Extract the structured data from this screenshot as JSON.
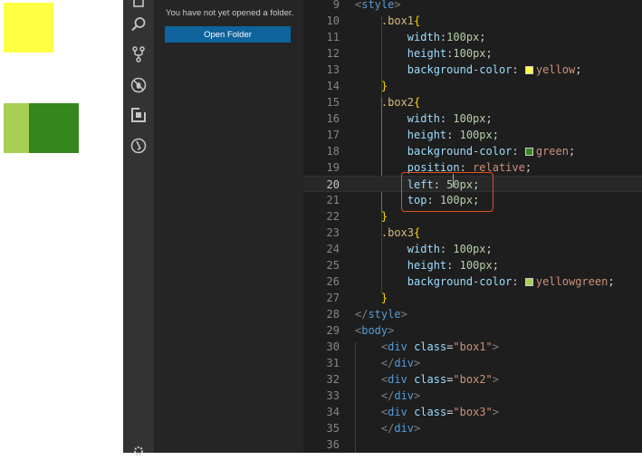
{
  "preview": {
    "box1_color": "#ffff44",
    "box2_color": "#35861d",
    "box3_color": "#a7cf53"
  },
  "sidebar": {
    "message": "You have not yet opened a folder.",
    "open_folder_label": "Open Folder"
  },
  "activity_icons": [
    "files-icon",
    "search-icon",
    "source-control-icon",
    "debug-icon",
    "extensions-icon",
    "remote-icon"
  ],
  "editor": {
    "current_line": 20,
    "lines": [
      {
        "n": "9",
        "indent": "",
        "tokens": [
          {
            "t": "<",
            "c": "c-angle"
          },
          {
            "t": "style",
            "c": "c-tag"
          },
          {
            "t": ">",
            "c": "c-angle"
          }
        ]
      },
      {
        "n": "10",
        "indent": "    ",
        "tokens": [
          {
            "t": ".box1",
            "c": "c-sel"
          },
          {
            "t": "{",
            "c": "c-brace"
          }
        ]
      },
      {
        "n": "11",
        "indent": "        ",
        "tokens": [
          {
            "t": "width",
            "c": "c-prop"
          },
          {
            "t": ":",
            "c": "c-punct"
          },
          {
            "t": "100px",
            "c": "c-num"
          },
          {
            "t": ";",
            "c": "c-punct"
          }
        ]
      },
      {
        "n": "12",
        "indent": "        ",
        "tokens": [
          {
            "t": "height",
            "c": "c-prop"
          },
          {
            "t": ":",
            "c": "c-punct"
          },
          {
            "t": "100px",
            "c": "c-num"
          },
          {
            "t": ";",
            "c": "c-punct"
          }
        ]
      },
      {
        "n": "13",
        "indent": "        ",
        "tokens": [
          {
            "t": "background-color",
            "c": "c-prop"
          },
          {
            "t": ": ",
            "c": "c-punct"
          },
          {
            "swatch": "#ffff44"
          },
          {
            "t": "yellow",
            "c": "c-val"
          },
          {
            "t": ";",
            "c": "c-punct"
          }
        ]
      },
      {
        "n": "14",
        "indent": "    ",
        "tokens": [
          {
            "t": "}",
            "c": "c-brace"
          }
        ]
      },
      {
        "n": "15",
        "indent": "    ",
        "tokens": [
          {
            "t": ".box2",
            "c": "c-sel"
          },
          {
            "t": "{",
            "c": "c-brace"
          }
        ]
      },
      {
        "n": "16",
        "indent": "        ",
        "tokens": [
          {
            "t": "width",
            "c": "c-prop"
          },
          {
            "t": ": ",
            "c": "c-punct"
          },
          {
            "t": "100px",
            "c": "c-num"
          },
          {
            "t": ";",
            "c": "c-punct"
          }
        ]
      },
      {
        "n": "17",
        "indent": "        ",
        "tokens": [
          {
            "t": "height",
            "c": "c-prop"
          },
          {
            "t": ": ",
            "c": "c-punct"
          },
          {
            "t": "100px",
            "c": "c-num"
          },
          {
            "t": ";",
            "c": "c-punct"
          }
        ]
      },
      {
        "n": "18",
        "indent": "        ",
        "tokens": [
          {
            "t": "background-color",
            "c": "c-prop"
          },
          {
            "t": ": ",
            "c": "c-punct"
          },
          {
            "swatch": "#35861d"
          },
          {
            "t": "green",
            "c": "c-val"
          },
          {
            "t": ";",
            "c": "c-punct"
          }
        ]
      },
      {
        "n": "19",
        "indent": "        ",
        "tokens": [
          {
            "t": "position",
            "c": "c-prop"
          },
          {
            "t": ": ",
            "c": "c-punct"
          },
          {
            "t": "relative",
            "c": "c-val"
          },
          {
            "t": ";",
            "c": "c-punct"
          }
        ]
      },
      {
        "n": "20",
        "indent": "        ",
        "tokens": [
          {
            "t": "left",
            "c": "c-prop"
          },
          {
            "t": ": ",
            "c": "c-punct"
          },
          {
            "t": "50px",
            "c": "c-num"
          },
          {
            "t": ";",
            "c": "c-punct"
          }
        ]
      },
      {
        "n": "21",
        "indent": "        ",
        "tokens": [
          {
            "t": "top",
            "c": "c-prop"
          },
          {
            "t": ": ",
            "c": "c-punct"
          },
          {
            "t": "100px",
            "c": "c-num"
          },
          {
            "t": ";",
            "c": "c-punct"
          }
        ]
      },
      {
        "n": "22",
        "indent": "    ",
        "tokens": [
          {
            "t": "}",
            "c": "c-brace"
          }
        ]
      },
      {
        "n": "23",
        "indent": "    ",
        "tokens": [
          {
            "t": ".box3",
            "c": "c-sel"
          },
          {
            "t": "{",
            "c": "c-brace"
          }
        ]
      },
      {
        "n": "24",
        "indent": "        ",
        "tokens": [
          {
            "t": "width",
            "c": "c-prop"
          },
          {
            "t": ": ",
            "c": "c-punct"
          },
          {
            "t": "100px",
            "c": "c-num"
          },
          {
            "t": ";",
            "c": "c-punct"
          }
        ]
      },
      {
        "n": "25",
        "indent": "        ",
        "tokens": [
          {
            "t": "height",
            "c": "c-prop"
          },
          {
            "t": ": ",
            "c": "c-punct"
          },
          {
            "t": "100px",
            "c": "c-num"
          },
          {
            "t": ";",
            "c": "c-punct"
          }
        ]
      },
      {
        "n": "26",
        "indent": "        ",
        "tokens": [
          {
            "t": "background-color",
            "c": "c-prop"
          },
          {
            "t": ": ",
            "c": "c-punct"
          },
          {
            "swatch": "#a7cf53"
          },
          {
            "t": "yellowgreen",
            "c": "c-val"
          },
          {
            "t": ";",
            "c": "c-punct"
          }
        ]
      },
      {
        "n": "27",
        "indent": "    ",
        "tokens": [
          {
            "t": "}",
            "c": "c-brace"
          }
        ]
      },
      {
        "n": "28",
        "indent": "",
        "tokens": [
          {
            "t": "</",
            "c": "c-angle"
          },
          {
            "t": "style",
            "c": "c-tag"
          },
          {
            "t": ">",
            "c": "c-angle"
          }
        ]
      },
      {
        "n": "29",
        "indent": "",
        "tokens": [
          {
            "t": "<",
            "c": "c-angle"
          },
          {
            "t": "body",
            "c": "c-tag"
          },
          {
            "t": ">",
            "c": "c-angle"
          }
        ]
      },
      {
        "n": "30",
        "indent": "    ",
        "tokens": [
          {
            "t": "<",
            "c": "c-angle"
          },
          {
            "t": "div",
            "c": "c-tag"
          },
          {
            "t": " ",
            "c": "c-punct"
          },
          {
            "t": "class",
            "c": "c-attr"
          },
          {
            "t": "=",
            "c": "c-punct"
          },
          {
            "t": "\"box1\"",
            "c": "c-str"
          },
          {
            "t": ">",
            "c": "c-angle"
          }
        ]
      },
      {
        "n": "31",
        "indent": "    ",
        "tokens": [
          {
            "t": "</",
            "c": "c-angle"
          },
          {
            "t": "div",
            "c": "c-tag"
          },
          {
            "t": ">",
            "c": "c-angle"
          }
        ]
      },
      {
        "n": "32",
        "indent": "    ",
        "tokens": [
          {
            "t": "<",
            "c": "c-angle"
          },
          {
            "t": "div",
            "c": "c-tag"
          },
          {
            "t": " ",
            "c": "c-punct"
          },
          {
            "t": "class",
            "c": "c-attr"
          },
          {
            "t": "=",
            "c": "c-punct"
          },
          {
            "t": "\"box2\"",
            "c": "c-str"
          },
          {
            "t": ">",
            "c": "c-angle"
          }
        ]
      },
      {
        "n": "33",
        "indent": "    ",
        "tokens": [
          {
            "t": "</",
            "c": "c-angle"
          },
          {
            "t": "div",
            "c": "c-tag"
          },
          {
            "t": ">",
            "c": "c-angle"
          }
        ]
      },
      {
        "n": "34",
        "indent": "    ",
        "tokens": [
          {
            "t": "<",
            "c": "c-angle"
          },
          {
            "t": "div",
            "c": "c-tag"
          },
          {
            "t": " ",
            "c": "c-punct"
          },
          {
            "t": "class",
            "c": "c-attr"
          },
          {
            "t": "=",
            "c": "c-punct"
          },
          {
            "t": "\"box3\"",
            "c": "c-str"
          },
          {
            "t": ">",
            "c": "c-angle"
          }
        ]
      },
      {
        "n": "35",
        "indent": "    ",
        "tokens": [
          {
            "t": "</",
            "c": "c-angle"
          },
          {
            "t": "div",
            "c": "c-tag"
          },
          {
            "t": ">",
            "c": "c-angle"
          }
        ]
      },
      {
        "n": "36",
        "indent": "",
        "tokens": []
      }
    ]
  },
  "highlight_color": "#e34f1d"
}
